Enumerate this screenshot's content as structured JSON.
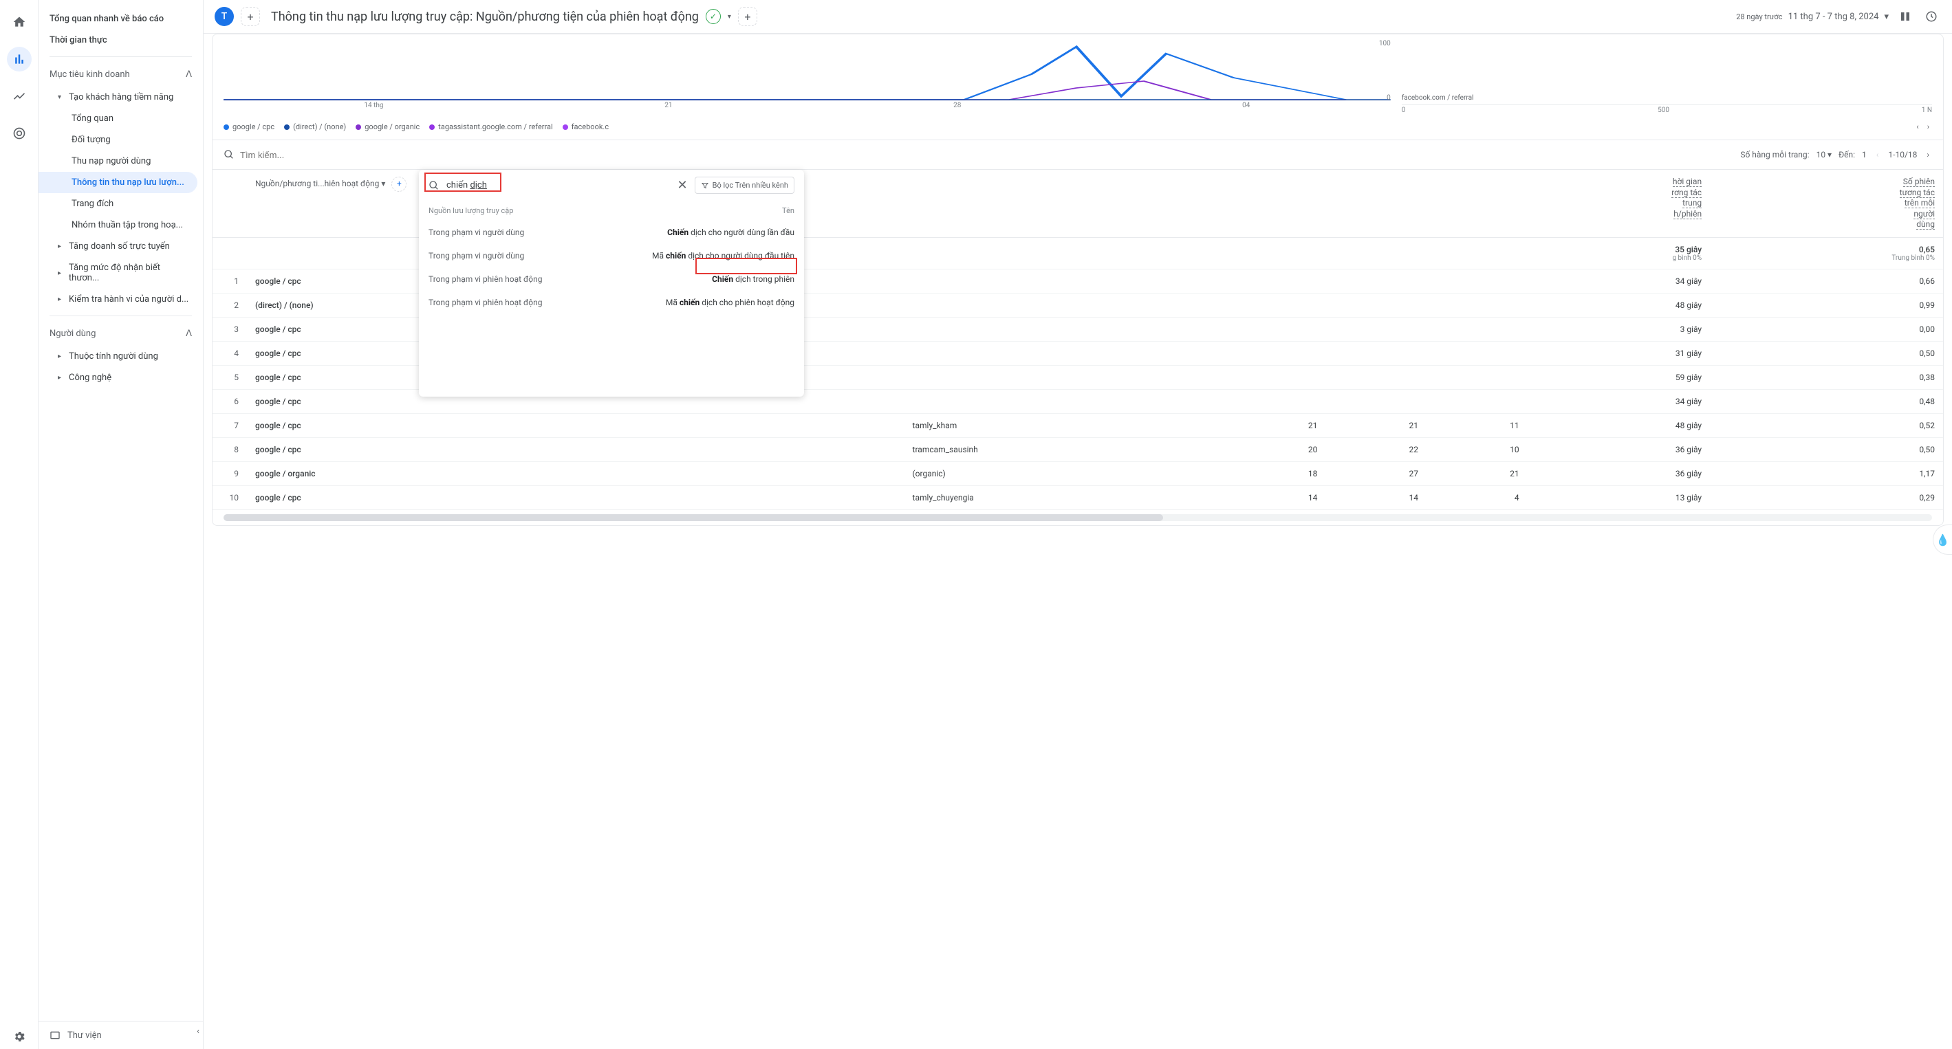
{
  "rail": {
    "icons": [
      "home",
      "reports",
      "explore",
      "advertising"
    ]
  },
  "sidebar": {
    "overview": "Tổng quan nhanh về báo cáo",
    "realtime": "Thời gian thực",
    "section_business": "Mục tiêu kinh doanh",
    "lead_gen": "Tạo khách hàng tiềm năng",
    "items": [
      "Tổng quan",
      "Đối tượng",
      "Thu nạp người dùng",
      "Thông tin thu nạp lưu lượn...",
      "Trang đích",
      "Nhóm thuần tập trong hoạ..."
    ],
    "collapsed": [
      "Tăng doanh số trực tuyến",
      "Tăng mức độ nhận biết thươn...",
      "Kiểm tra hành vi của người d..."
    ],
    "section_user": "Người dùng",
    "user_items": [
      "Thuộc tính người dùng",
      "Công nghệ"
    ],
    "library": "Thư viện"
  },
  "header": {
    "avatar": "T",
    "title": "Thông tin thu nạp lưu lượng truy cập: Nguồn/phương tiện của phiên hoạt động",
    "date_label": "28 ngày trước",
    "date_range": "11 thg 7 - 7 thg 8, 2024"
  },
  "chart_data": {
    "type": "line",
    "x_labels": [
      "14 thg",
      "21",
      "28",
      "04"
    ],
    "y_ticks": [
      "100",
      "0"
    ],
    "series": [
      {
        "name": "google / cpc",
        "color": "#1a73e8"
      },
      {
        "name": "(direct) / (none)",
        "color": "#174ea6"
      },
      {
        "name": "google / organic",
        "color": "#8430ce"
      },
      {
        "name": "tagassistant.google.com / referral",
        "color": "#9334e6"
      },
      {
        "name": "facebook.c",
        "color": "#a142f4"
      }
    ],
    "bar_label": "facebook.com / referral",
    "bar_x": [
      "0",
      "500",
      "1 N"
    ]
  },
  "search": {
    "placeholder": "Tìm kiếm..."
  },
  "pagination": {
    "rows_label": "Số hàng mỗi trang:",
    "rows_value": "10",
    "goto_label": "Đến:",
    "goto_value": "1",
    "range": "1-10/18"
  },
  "table": {
    "dim_col": "Nguồn/phương ti...hiên hoạt động",
    "col_time": [
      "hời gian",
      "rơng tác",
      "trung",
      "h/phiên"
    ],
    "col_time_header": "hời gian\nrơng tác\ntrung\nh/phiên",
    "col_sessions": "Số phiên\ntương tác\ntrên mỗi\nngười\ndùng",
    "summary_time": "35 giây",
    "summary_time_sub": "g bình 0%",
    "summary_sess": "0,65",
    "summary_sess_sub": "Trung bình 0%",
    "rows": [
      {
        "i": "1",
        "src": "google / cpc",
        "camp": "",
        "c1": "",
        "c2": "",
        "c3": "",
        "time": "34 giây",
        "sess": "0,66"
      },
      {
        "i": "2",
        "src": "(direct) / (none)",
        "camp": "",
        "c1": "",
        "c2": "",
        "c3": "",
        "time": "48 giây",
        "sess": "0,99"
      },
      {
        "i": "3",
        "src": "google / cpc",
        "camp": "",
        "c1": "",
        "c2": "",
        "c3": "",
        "time": "3 giây",
        "sess": "0,00"
      },
      {
        "i": "4",
        "src": "google / cpc",
        "camp": "",
        "c1": "",
        "c2": "",
        "c3": "",
        "time": "31 giây",
        "sess": "0,50"
      },
      {
        "i": "5",
        "src": "google / cpc",
        "camp": "",
        "c1": "",
        "c2": "",
        "c3": "",
        "time": "59 giây",
        "sess": "0,38"
      },
      {
        "i": "6",
        "src": "google / cpc",
        "camp": "",
        "c1": "",
        "c2": "",
        "c3": "",
        "time": "34 giây",
        "sess": "0,48"
      },
      {
        "i": "7",
        "src": "google / cpc",
        "camp": "tamly_kham",
        "c1": "21",
        "c2": "21",
        "c3": "11",
        "time": "48 giây",
        "sess": "0,52"
      },
      {
        "i": "8",
        "src": "google / cpc",
        "camp": "tramcam_sausinh",
        "c1": "20",
        "c2": "22",
        "c3": "10",
        "time": "36 giây",
        "sess": "0,50"
      },
      {
        "i": "9",
        "src": "google / organic",
        "camp": "(organic)",
        "c1": "18",
        "c2": "27",
        "c3": "21",
        "time": "36 giây",
        "sess": "1,17"
      },
      {
        "i": "10",
        "src": "google / cpc",
        "camp": "tamly_chuyengia",
        "c1": "14",
        "c2": "14",
        "c3": "4",
        "time": "13 giây",
        "sess": "0,29"
      }
    ]
  },
  "dropdown": {
    "search_value": "chiến dịch",
    "search_plain": "chiến ",
    "search_underlined": "dịch",
    "filter_btn": "Bộ lọc Trên nhiều kênh",
    "col_scope": "Nguồn lưu lượng truy cập",
    "col_name": "Tên",
    "rows": [
      {
        "scope": "Trong phạm vi người dùng",
        "prefix": "",
        "bold": "Chiến",
        "suffix": " dịch cho người dùng lần đầu"
      },
      {
        "scope": "Trong phạm vi người dùng",
        "prefix": "Mã ",
        "bold": "chiến",
        "suffix": " dịch cho người dùng đầu tiên"
      },
      {
        "scope": "Trong phạm vi phiên hoạt động",
        "prefix": "",
        "bold": "Chiến",
        "suffix": " dịch trong phiên"
      },
      {
        "scope": "Trong phạm vi phiên hoạt động",
        "prefix": "Mã ",
        "bold": "chiến",
        "suffix": " dịch cho phiên hoạt động"
      }
    ]
  }
}
